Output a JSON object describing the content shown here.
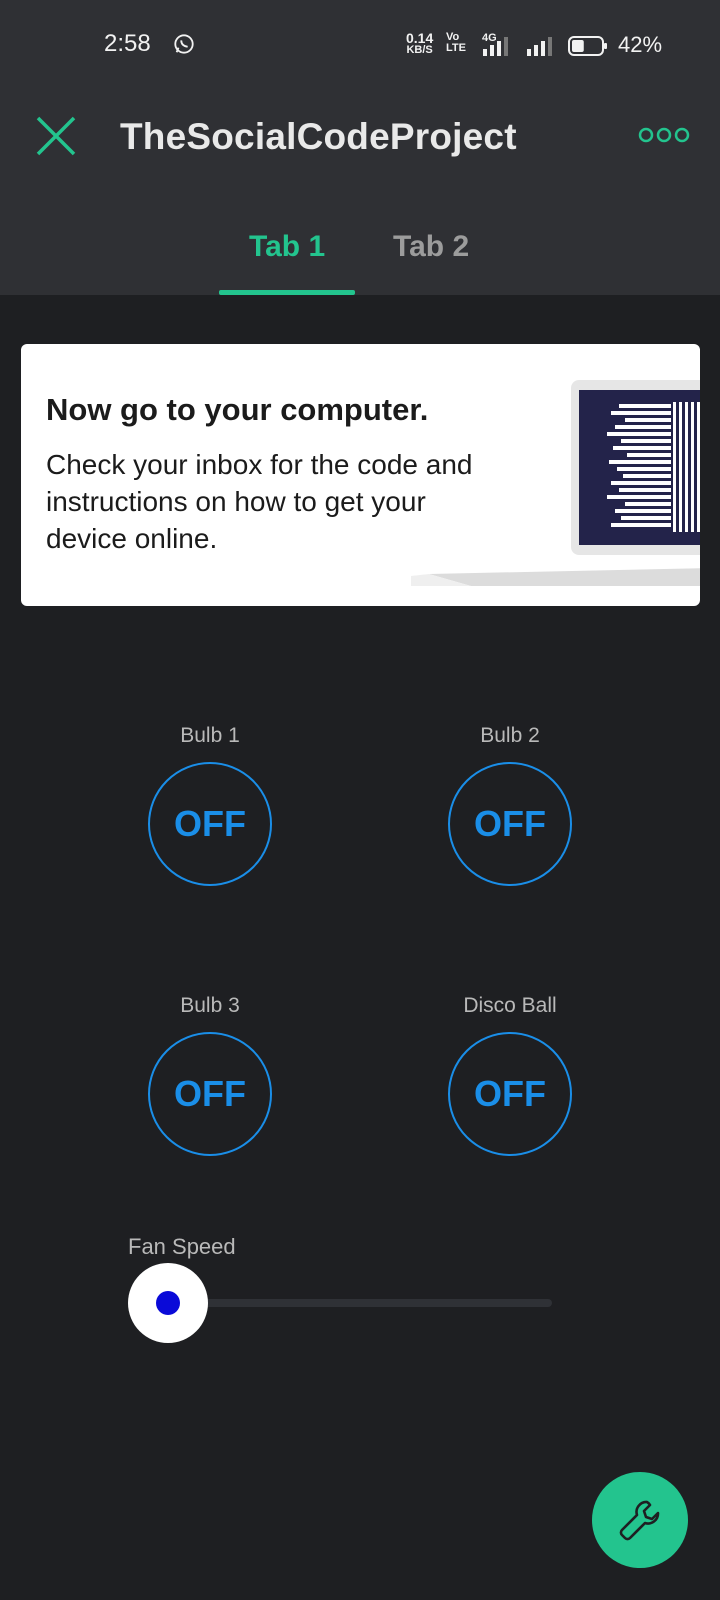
{
  "status_bar": {
    "time": "2:58",
    "net_speed_value": "0.14",
    "net_speed_unit": "KB/S",
    "volte_top": "Vo",
    "volte_bottom": "LTE",
    "network_type": "4G",
    "battery_percent": "42%",
    "battery_level": 0.42,
    "icons": [
      "whatsapp-icon",
      "signal-icon",
      "battery-icon"
    ]
  },
  "header": {
    "title": "TheSocialCodeProject",
    "close_icon": "close-icon",
    "more_icon": "more-options-icon"
  },
  "tabs": [
    {
      "label": "Tab 1",
      "active": true
    },
    {
      "label": "Tab 2",
      "active": false
    }
  ],
  "info_card": {
    "title": "Now go to your computer.",
    "body": "Check your inbox for the code and instructions on how to get your device online.",
    "image": "laptop-illustration"
  },
  "buttons": [
    {
      "label": "Bulb 1",
      "state": "OFF"
    },
    {
      "label": "Bulb 2",
      "state": "OFF"
    },
    {
      "label": "Bulb 3",
      "state": "OFF"
    },
    {
      "label": "Disco Ball",
      "state": "OFF"
    }
  ],
  "slider": {
    "label": "Fan Speed",
    "value_fraction": 0
  },
  "fab": {
    "icon": "wrench-icon"
  },
  "colors": {
    "accent": "#23c48e",
    "button": "#1a8ee8",
    "background": "#1e1f22",
    "header": "#2f3034",
    "slider_dot": "#0a0ad8"
  }
}
